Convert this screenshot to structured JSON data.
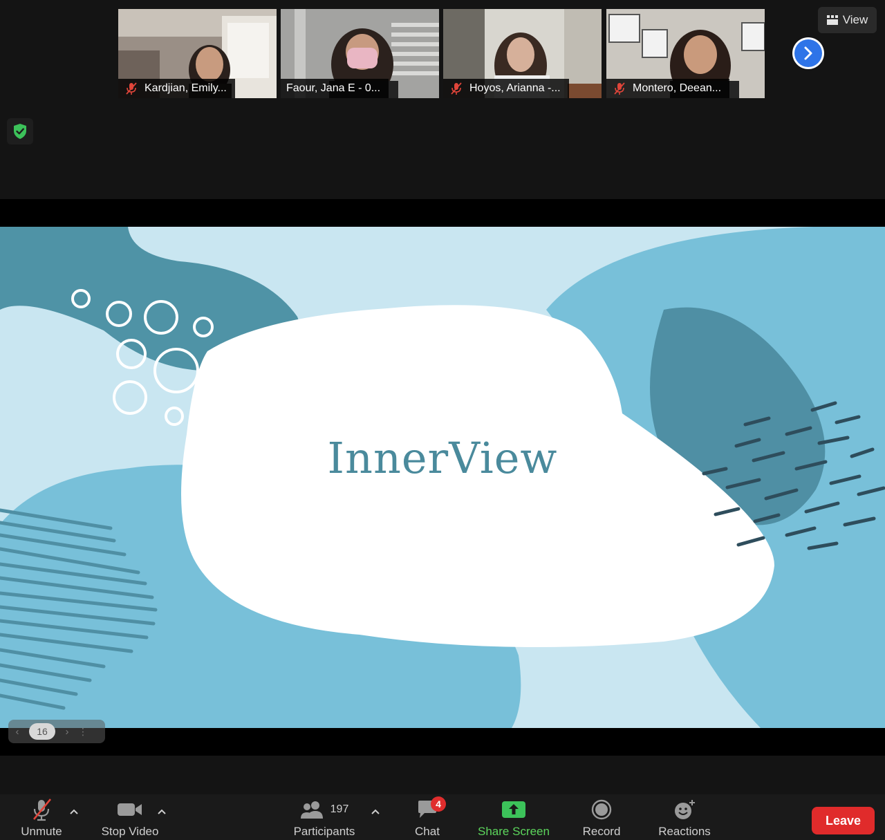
{
  "participants": [
    {
      "name": "Kardjian, Emily...",
      "muted": true
    },
    {
      "name": "Faour, Jana E - 0...",
      "muted": false
    },
    {
      "name": "Hoyos, Arianna -...",
      "muted": true
    },
    {
      "name": "Montero, Deean...",
      "muted": true
    }
  ],
  "view_button": {
    "label": "View"
  },
  "slide": {
    "title": "InnerView",
    "page_number": "16"
  },
  "toolbar": {
    "unmute_label": "Unmute",
    "stop_video_label": "Stop Video",
    "participants_label": "Participants",
    "participants_count": "197",
    "chat_label": "Chat",
    "chat_badge": "4",
    "share_screen_label": "Share Screen",
    "record_label": "Record",
    "reactions_label": "Reactions",
    "leave_label": "Leave"
  },
  "colors": {
    "accent_blue": "#2e74e8",
    "leave_red": "#e02b2b",
    "share_green": "#5cd65c",
    "slide_title": "#4a8a9c"
  },
  "icons": [
    "mic-muted-icon",
    "shield-check-icon",
    "chevron-right-icon",
    "grid-view-icon",
    "video-icon",
    "participants-icon",
    "chat-icon",
    "share-screen-icon",
    "record-icon",
    "reactions-icon",
    "caret-up-icon"
  ]
}
